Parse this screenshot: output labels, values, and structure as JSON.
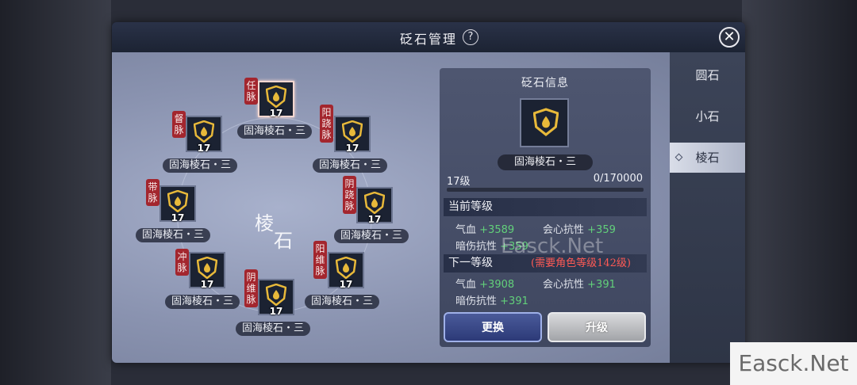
{
  "dialog": {
    "title": "砭石管理",
    "help_glyph": "?",
    "close_glyph": "✕"
  },
  "tabs": [
    {
      "label": "圆石",
      "active": false
    },
    {
      "label": "小石",
      "active": false
    },
    {
      "label": "棱石",
      "active": true
    }
  ],
  "wheel": {
    "center_label_1": "棱",
    "center_label_2": "石",
    "slots": [
      {
        "tag": "任脉",
        "name": "固海棱石・三",
        "level": "17",
        "selected": true
      },
      {
        "tag": "督脉",
        "name": "固海棱石・三",
        "level": "17",
        "selected": false
      },
      {
        "tag": "阳跷脉",
        "name": "固海棱石・三",
        "level": "17",
        "selected": false
      },
      {
        "tag": "带脉",
        "name": "固海棱石・三",
        "level": "17",
        "selected": false
      },
      {
        "tag": "阴跷脉",
        "name": "固海棱石・三",
        "level": "17",
        "selected": false
      },
      {
        "tag": "冲脉",
        "name": "固海棱石・三",
        "level": "17",
        "selected": false
      },
      {
        "tag": "阳维脉",
        "name": "固海棱石・三",
        "level": "17",
        "selected": false
      },
      {
        "tag": "阴维脉",
        "name": "固海棱石・三",
        "level": "17",
        "selected": false
      }
    ]
  },
  "info": {
    "title": "砭石信息",
    "stone_name": "固海棱石・三",
    "level_label": "17级",
    "exp_text": "0/170000",
    "exp_fraction": 0.0,
    "current": {
      "header": "当前等级",
      "stats": [
        {
          "label": "气血",
          "value": "+3589"
        },
        {
          "label": "会心抗性",
          "value": "+359"
        },
        {
          "label": "暗伤抗性",
          "value": "+359"
        }
      ]
    },
    "next": {
      "header": "下一等级",
      "requirement": "(需要角色等级142级)",
      "stats": [
        {
          "label": "气血",
          "value": "+3908"
        },
        {
          "label": "会心抗性",
          "value": "+391"
        },
        {
          "label": "暗伤抗性",
          "value": "+391"
        }
      ]
    },
    "replace_label": "更换",
    "upgrade_label": "升级"
  },
  "watermarks": {
    "center": "Easck.Net",
    "corner": "Easck.Net"
  },
  "colors": {
    "tag_red": "#a3262e",
    "stat_green": "#62d07a",
    "requirement_red": "#ff5a55"
  }
}
